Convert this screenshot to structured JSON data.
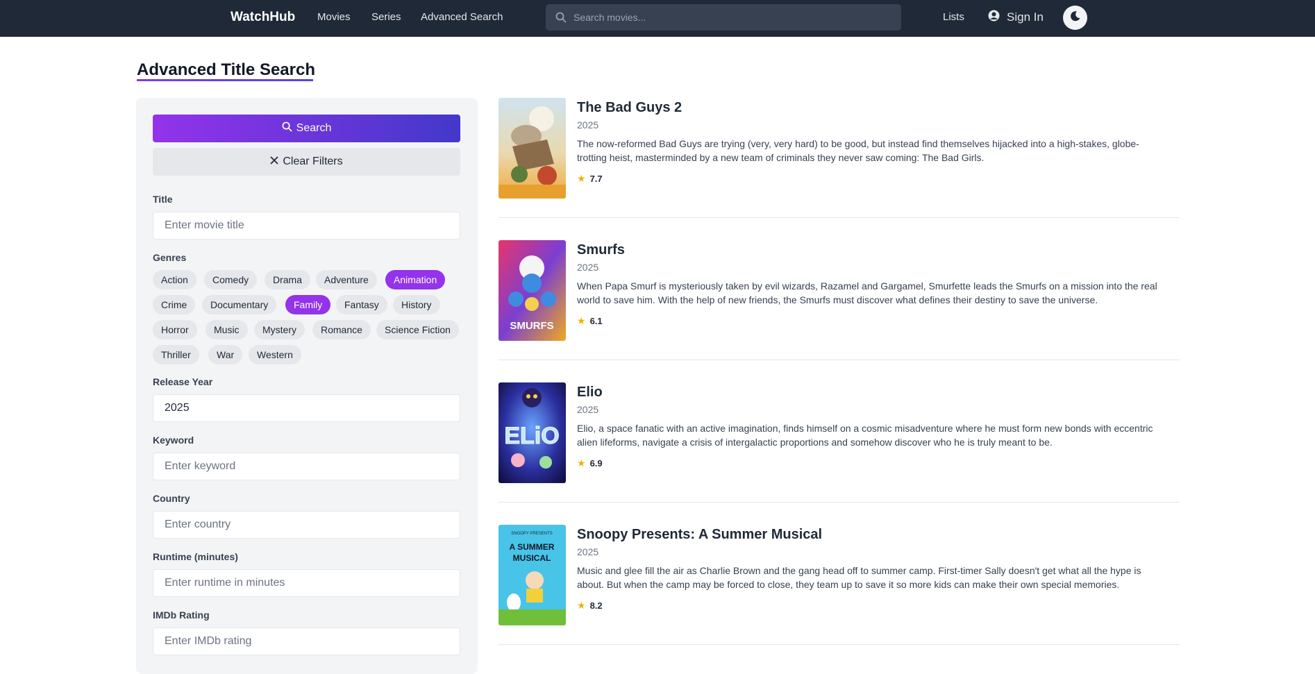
{
  "nav": {
    "brand": "WatchHub",
    "links": [
      "Movies",
      "Series",
      "Advanced Search"
    ],
    "search_placeholder": "Search movies...",
    "lists": "Lists",
    "sign_in": "Sign In"
  },
  "page": {
    "title": "Advanced Title Search"
  },
  "filters": {
    "search_button": "Search",
    "clear_button": "Clear Filters",
    "title_label": "Title",
    "title_placeholder": "Enter movie title",
    "genres_label": "Genres",
    "genres": [
      {
        "name": "Action",
        "selected": false
      },
      {
        "name": "Comedy",
        "selected": false
      },
      {
        "name": "Drama",
        "selected": false
      },
      {
        "name": "Adventure",
        "selected": false
      },
      {
        "name": "Animation",
        "selected": true
      },
      {
        "name": "Crime",
        "selected": false
      },
      {
        "name": "Documentary",
        "selected": false
      },
      {
        "name": "Family",
        "selected": true
      },
      {
        "name": "Fantasy",
        "selected": false
      },
      {
        "name": "History",
        "selected": false
      },
      {
        "name": "Horror",
        "selected": false
      },
      {
        "name": "Music",
        "selected": false
      },
      {
        "name": "Mystery",
        "selected": false
      },
      {
        "name": "Romance",
        "selected": false
      },
      {
        "name": "Science Fiction",
        "selected": false
      },
      {
        "name": "Thriller",
        "selected": false
      },
      {
        "name": "War",
        "selected": false
      },
      {
        "name": "Western",
        "selected": false
      }
    ],
    "release_year_label": "Release Year",
    "release_year_value": "2025",
    "keyword_label": "Keyword",
    "keyword_placeholder": "Enter keyword",
    "country_label": "Country",
    "country_placeholder": "Enter country",
    "runtime_label": "Runtime (minutes)",
    "runtime_placeholder": "Enter runtime in minutes",
    "imdb_label": "IMDb Rating",
    "imdb_placeholder": "Enter IMDb rating"
  },
  "results": [
    {
      "title": "The Bad Guys 2",
      "year": "2025",
      "description": "The now-reformed Bad Guys are trying (very, very hard) to be good, but instead find themselves hijacked into a high-stakes, globe-trotting heist, masterminded by a new team of criminals they never saw coming: The Bad Girls.",
      "rating": "7.7"
    },
    {
      "title": "Smurfs",
      "year": "2025",
      "description": "When Papa Smurf is mysteriously taken by evil wizards, Razamel and Gargamel, Smurfette leads the Smurfs on a mission into the real world to save him. With the help of new friends, the Smurfs must discover what defines their destiny to save the universe.",
      "rating": "6.1"
    },
    {
      "title": "Elio",
      "year": "2025",
      "description": "Elio, a space fanatic with an active imagination, finds himself on a cosmic misadventure where he must form new bonds with eccentric alien lifeforms, navigate a crisis of intergalactic proportions and somehow discover who he is truly meant to be.",
      "rating": "6.9"
    },
    {
      "title": "Snoopy Presents: A Summer Musical",
      "year": "2025",
      "description": "Music and glee fill the air as Charlie Brown and the gang head off to summer camp. First-timer Sally doesn't get what all the hype is about. But when the camp may be forced to close, they team up to save it so more kids can make their own special memories.",
      "rating": "8.2"
    }
  ],
  "posters": {
    "smurfs_text": "SMURFS",
    "elio_text": "ELiO",
    "snoopy_top": "SNOOPY PRESENTS",
    "snoopy_title_1": "A SUMMER",
    "snoopy_title_2": "MUSICAL"
  },
  "colors": {
    "nav_bg": "#1f2937",
    "accent_purple": "#9333ea",
    "accent_indigo": "#4338ca",
    "star": "#eab308"
  }
}
